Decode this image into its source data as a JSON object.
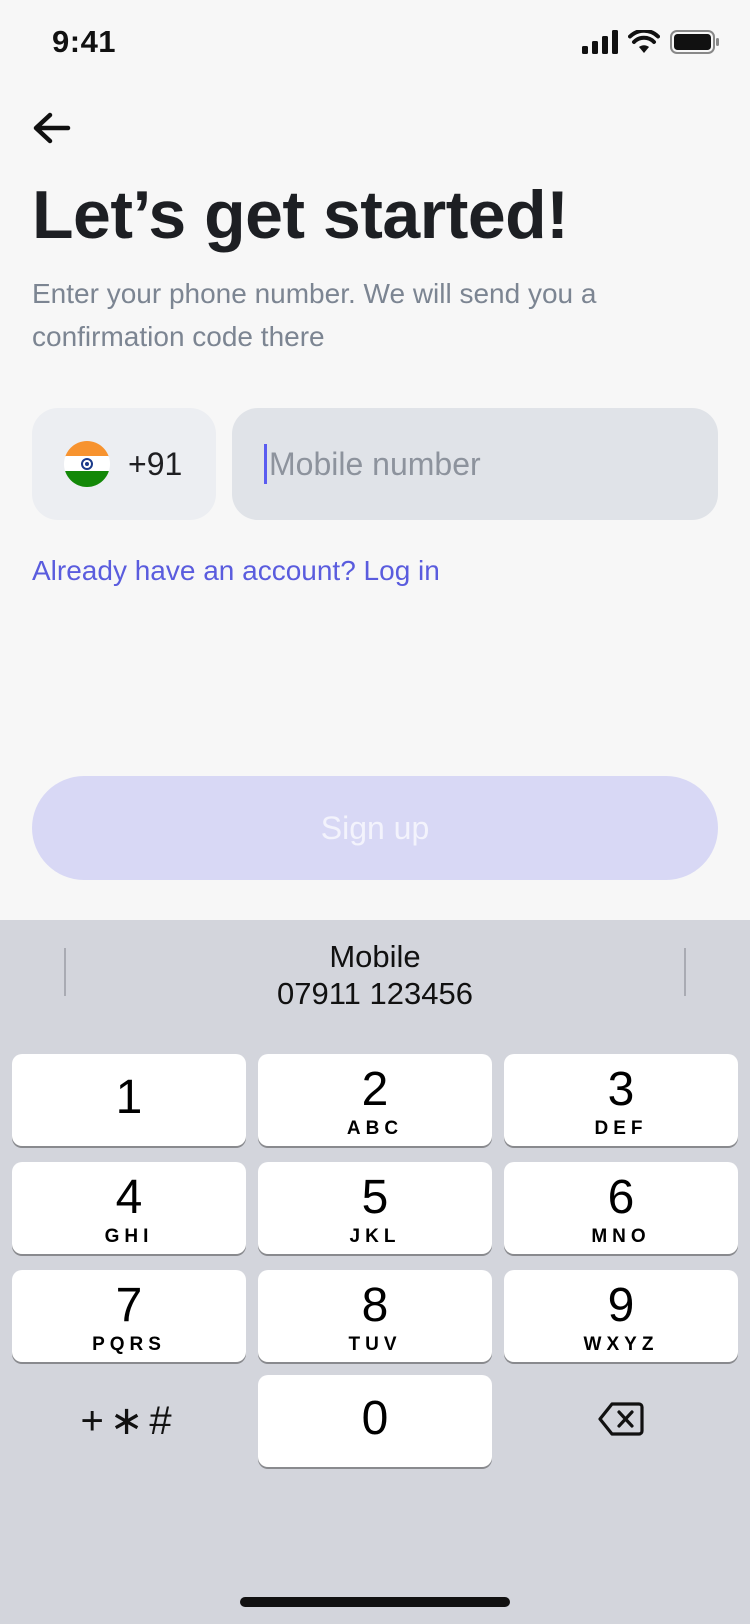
{
  "status_bar": {
    "time": "9:41",
    "icons": [
      "signal-icon",
      "wifi-icon",
      "battery-icon"
    ]
  },
  "header": {
    "back_icon": "arrow-left-icon",
    "title": "Let’s get started!",
    "subtitle": "Enter your phone number. We will send you a confirmation code there"
  },
  "phone": {
    "country_flag": "india-flag-icon",
    "dial_code": "+91",
    "value": "",
    "placeholder": "Mobile number"
  },
  "login_link": "Already have an account? Log in",
  "signup_button": "Sign up",
  "keyboard": {
    "suggestion_label": "Mobile",
    "suggestion_value": "07911 123456",
    "keys": [
      {
        "num": "1",
        "letters": ""
      },
      {
        "num": "2",
        "letters": "ABC"
      },
      {
        "num": "3",
        "letters": "DEF"
      },
      {
        "num": "4",
        "letters": "GHI"
      },
      {
        "num": "5",
        "letters": "JKL"
      },
      {
        "num": "6",
        "letters": "MNO"
      },
      {
        "num": "7",
        "letters": "PQRS"
      },
      {
        "num": "8",
        "letters": "TUV"
      },
      {
        "num": "9",
        "letters": "WXYZ"
      },
      {
        "num": "0",
        "letters": ""
      }
    ],
    "symbols_label": "+∗#",
    "delete_icon": "backspace-icon"
  },
  "colors": {
    "accent": "#5a5cde",
    "button_disabled_bg": "#d8d8f5",
    "keyboard_bg": "#d3d5dc"
  }
}
